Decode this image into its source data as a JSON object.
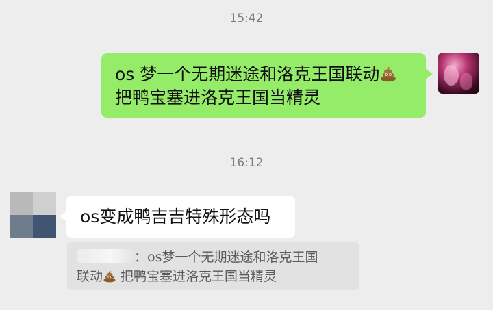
{
  "chat": {
    "timestamps": [
      "15:42",
      "16:12"
    ],
    "messages": [
      {
        "from": "self",
        "line1": "os 梦一个无期迷途和洛克王国联动",
        "line2": "把鸭宝塞进洛克王国当精灵"
      },
      {
        "from": "other",
        "text": "os变成鸭吉吉特殊形态吗",
        "quote": {
          "separator": "：",
          "line1": "os梦一个无期迷途和洛克王国",
          "line2_prefix": "联动",
          "line2_suffix": " 把鸭宝塞进洛克王国当精灵"
        }
      }
    ]
  },
  "colors": {
    "background": "#ededed",
    "self_bubble": "#95ec69",
    "other_bubble": "#ffffff",
    "quote_background": "#e2e2e2"
  },
  "icons": {
    "emoji": "poop-icon"
  }
}
